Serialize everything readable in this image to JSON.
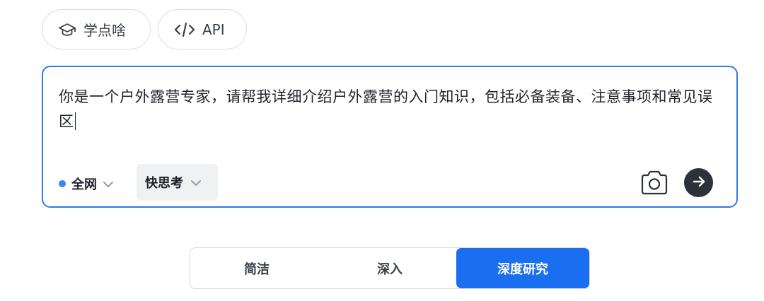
{
  "chips": {
    "study_label": "学点啥",
    "api_label": "API"
  },
  "input": {
    "value": "你是一个户外露营专家，请帮我详细介绍户外露营的入门知识，包括必备装备、注意事项和常见误区"
  },
  "controls": {
    "scope_selected": "全网",
    "think_mode_selected": "快思考"
  },
  "depth_selector": {
    "options": [
      "简洁",
      "深入",
      "深度研究"
    ],
    "selected_index": 2
  },
  "colors": {
    "accent": "#2f7ae5",
    "active_segment": "#1a6ff0",
    "send_button": "#2d3139"
  },
  "icons": {
    "study": "graduation-cap-icon",
    "api": "code-icon",
    "scope_indicator": "dot-icon",
    "dropdown": "chevron-down-icon",
    "camera": "camera-icon",
    "send": "arrow-right-icon"
  }
}
